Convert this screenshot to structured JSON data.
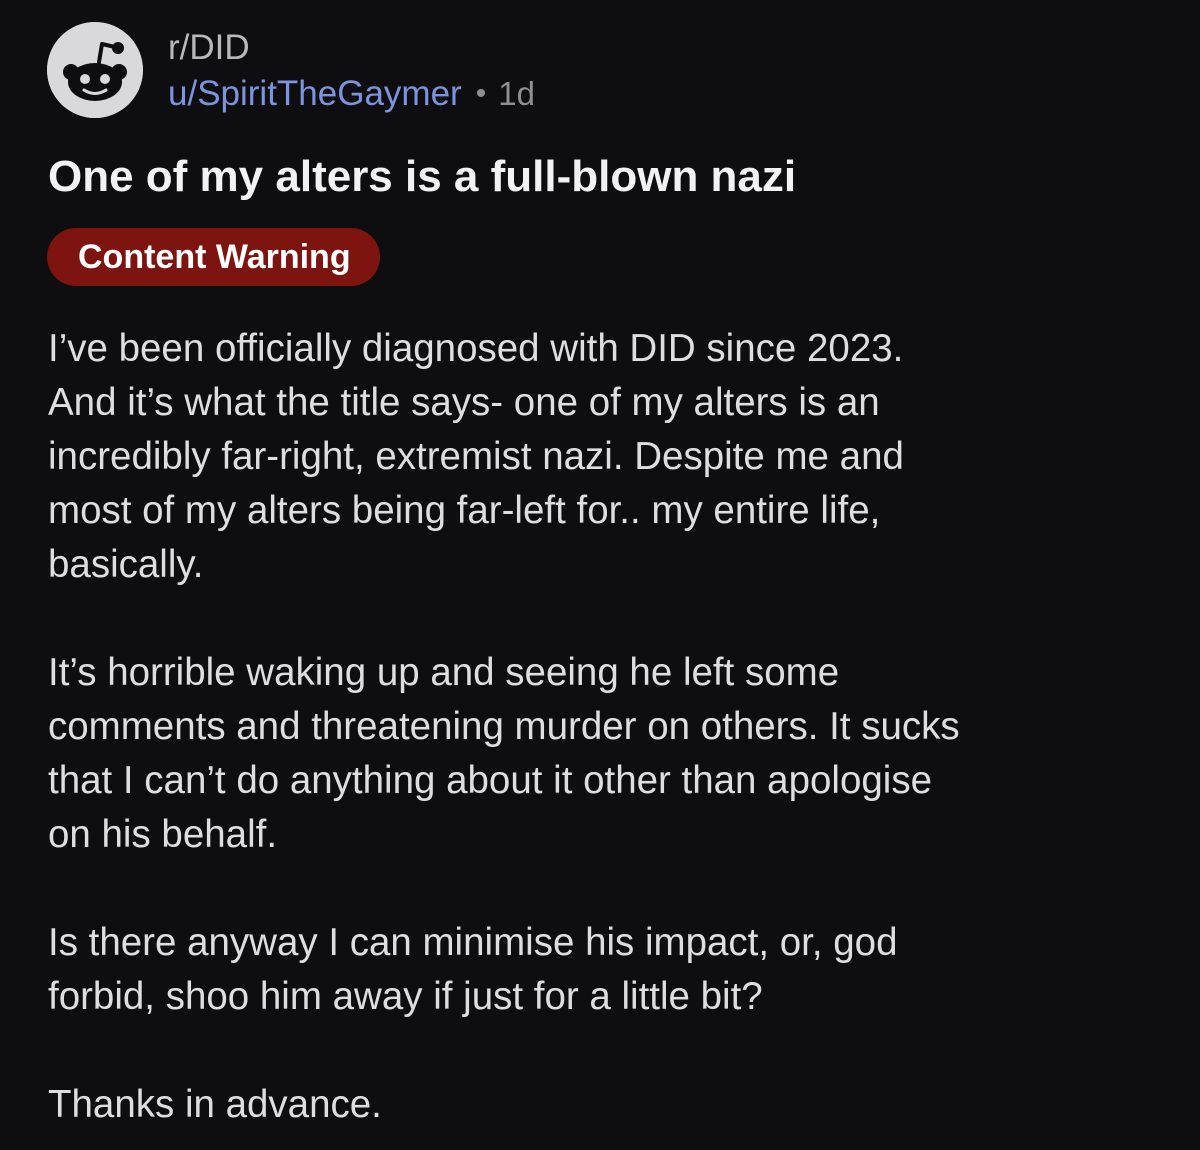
{
  "post": {
    "subreddit": "r/DID",
    "author": "u/SpiritTheGaymer",
    "separator": "•",
    "age": "1d",
    "title": "One of my alters is a full-blown nazi",
    "flair": "Content Warning",
    "avatar_icon": "reddit-snoo-icon",
    "colors": {
      "background": "#0e0e10",
      "username": "#7c94de",
      "flair_background": "#7e1410"
    },
    "paragraphs": [
      {
        "lines": [
          "I’ve been officially diagnosed with DID since 2023.",
          "And it’s what the title says- one of my alters is an",
          "incredibly far-right, extremist nazi. Despite me and",
          "most of my alters being far-left for.. my entire life,",
          "basically."
        ]
      },
      {
        "lines": [
          "It’s horrible waking up and seeing he left some",
          "comments and threatening murder on others. It sucks",
          "that I can’t do anything about it other than apologise",
          "on his behalf."
        ]
      },
      {
        "lines": [
          "Is there anyway I can minimise his impact, or, god",
          "forbid, shoo him away if just for a little bit?"
        ]
      },
      {
        "lines": [
          "Thanks in advance."
        ]
      }
    ]
  }
}
